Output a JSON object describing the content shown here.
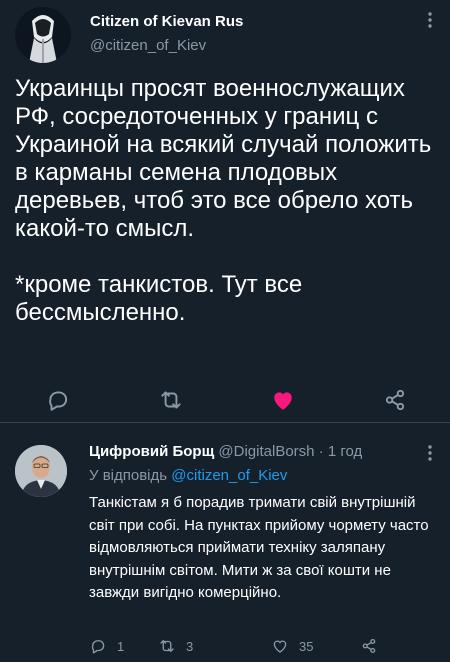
{
  "tweet": {
    "author_name": "Citizen of Kievan Rus",
    "author_handle": "@citizen_of_Kiev",
    "text_p1": "Украинцы просят военнослужащих РФ, сосредоточенных у границ с Украиной на всякий случай положить в карманы семена плодовых деревьев, чтоб это все обрело хоть какой-то смысл.",
    "text_p2": "*кроме танкистов. Тут все бессмысленно.",
    "liked": true
  },
  "reply": {
    "author_name": "Цифровий Борщ",
    "author_handle": "@DigitalBorsh",
    "separator": "·",
    "time": "1 год",
    "reply_to_prefix": "У відповідь",
    "reply_to_handle": "@citizen_of_Kiev",
    "text": "Танкістам я б порадив тримати свій внутрішній світ при собі. На пунктах прийому чормету часто відмовляються приймати техніку заляпану внутрішнім світом. Мити ж за свої кошти не завжди вигідно комерційно.",
    "reply_count": "1",
    "retweet_count": "3",
    "like_count": "35"
  },
  "colors": {
    "background": "#15202b",
    "secondary_text": "#8b98a5",
    "link": "#1d9bf0",
    "like": "#f91880",
    "divider": "#38444d"
  },
  "icons": [
    "more-icon",
    "reply-icon",
    "retweet-icon",
    "like-icon",
    "share-icon"
  ]
}
